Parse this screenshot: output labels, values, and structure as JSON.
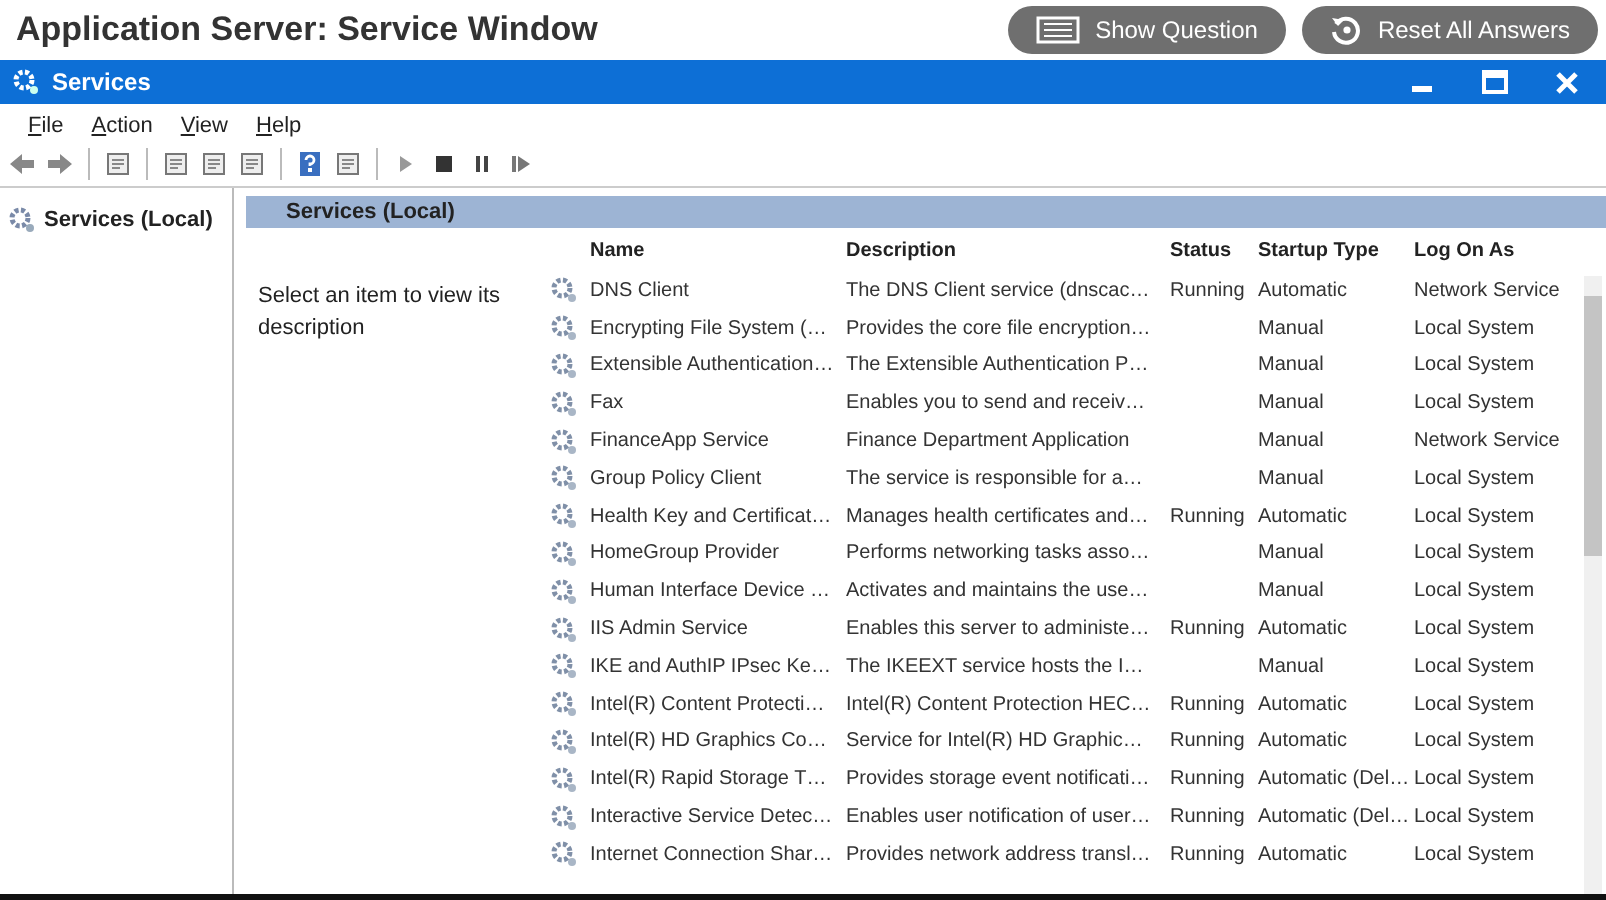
{
  "header": {
    "title": "Application Server: Service Window",
    "buttons": [
      {
        "kind": "question",
        "label": "Show Question"
      },
      {
        "kind": "reset",
        "label": "Reset All Answers"
      }
    ]
  },
  "window": {
    "title": "Services"
  },
  "menu": [
    "File",
    "Action",
    "View",
    "Help"
  ],
  "tree": {
    "items": [
      {
        "label": "Services (Local)",
        "selected": false
      }
    ]
  },
  "panel": {
    "tab": "Services (Local)",
    "hint": "Select an item to view its description"
  },
  "table": {
    "columns": [
      "Name",
      "Description",
      "Status",
      "Startup Type",
      "Log On As"
    ],
    "rows": [
      {
        "name": "DNS Client",
        "description": "The DNS Client service (dnscac…",
        "status": "Running",
        "startup_type": "Automatic",
        "log_on_as": "Network Service"
      },
      {
        "name": "Encrypting File System (…",
        "description": "Provides the core file encryption…",
        "startup_type": "Manual",
        "log_on_as": "Local System"
      },
      {
        "name": "Extensible Authentication…",
        "description": "The Extensible Authentication P…",
        "startup_type": "Manual",
        "log_on_as": "Local System"
      },
      {
        "name": "Fax",
        "description": "Enables you to send and receiv…",
        "startup_type": "Manual",
        "log_on_as": "Local System"
      },
      {
        "name": "FinanceApp Service",
        "description": "Finance Department Application",
        "startup_type": "Manual",
        "log_on_as": "Network Service"
      },
      {
        "name": "Group Policy Client",
        "description": "The service is responsible for a…",
        "startup_type": "Manual",
        "log_on_as": "Local System"
      },
      {
        "name": "Health Key and Certificat…",
        "description": "Manages health certificates and…",
        "status": "Running",
        "startup_type": "Automatic",
        "log_on_as": "Local System"
      },
      {
        "name": "HomeGroup Provider",
        "description": "Performs networking tasks asso…",
        "startup_type": "Manual",
        "log_on_as": "Local System"
      },
      {
        "name": "Human Interface Device …",
        "description": "Activates and maintains the use…",
        "startup_type": "Manual",
        "log_on_as": "Local System"
      },
      {
        "name": "IIS Admin Service",
        "description": "Enables this server to administe…",
        "status": "Running",
        "startup_type": "Automatic",
        "log_on_as": "Local System"
      },
      {
        "name": "IKE and AuthIP IPsec Ke…",
        "description": "The IKEEXT service hosts the I…",
        "startup_type": "Manual",
        "log_on_as": "Local System"
      },
      {
        "name": "Intel(R) Content Protecti…",
        "description": "Intel(R) Content Protection HEC…",
        "status": "Running",
        "startup_type": "Automatic",
        "log_on_as": "Local System"
      },
      {
        "name": "Intel(R) HD Graphics Co…",
        "description": "Service for Intel(R) HD Graphic…",
        "status": "Running",
        "startup_type": "Automatic",
        "log_on_as": "Local System"
      },
      {
        "name": "Intel(R) Rapid Storage T…",
        "description": "Provides storage event notificati…",
        "status": "Running",
        "startup_type": "Automatic (Del…",
        "log_on_as": "Local System"
      },
      {
        "name": "Interactive Service Detec…",
        "description": "Enables user notification of user…",
        "status": "Running",
        "startup_type": "Automatic (Del…",
        "log_on_as": "Local System"
      },
      {
        "name": "Internet Connection Shar…",
        "description": "Provides network address transl…",
        "status": "Running",
        "startup_type": "Automatic",
        "log_on_as": "Local System"
      }
    ]
  }
}
